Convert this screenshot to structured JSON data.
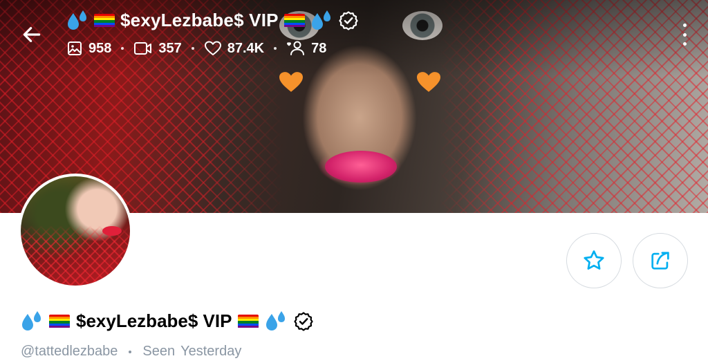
{
  "header": {
    "title": "$exyLezbabe$ VIP",
    "stats": {
      "photos": "958",
      "videos": "357",
      "likes": "87.4K",
      "subscribers": "78"
    }
  },
  "profile": {
    "name": "$exyLezbabe$ VIP",
    "username": "@tattedlezbabe",
    "seen_label": "Seen",
    "seen_value": "Yesterday"
  },
  "colors": {
    "accent": "#00aff0",
    "muted": "#8a96a3",
    "border": "#d6dbe0"
  },
  "icons": [
    "back-arrow-icon",
    "sweat-droplets-emoji",
    "rainbow-flag-emoji",
    "verified-badge-icon",
    "photo-icon",
    "video-icon",
    "heart-icon",
    "subscribers-icon",
    "more-vertical-icon",
    "star-icon",
    "share-icon",
    "orange-heart-emoji"
  ]
}
